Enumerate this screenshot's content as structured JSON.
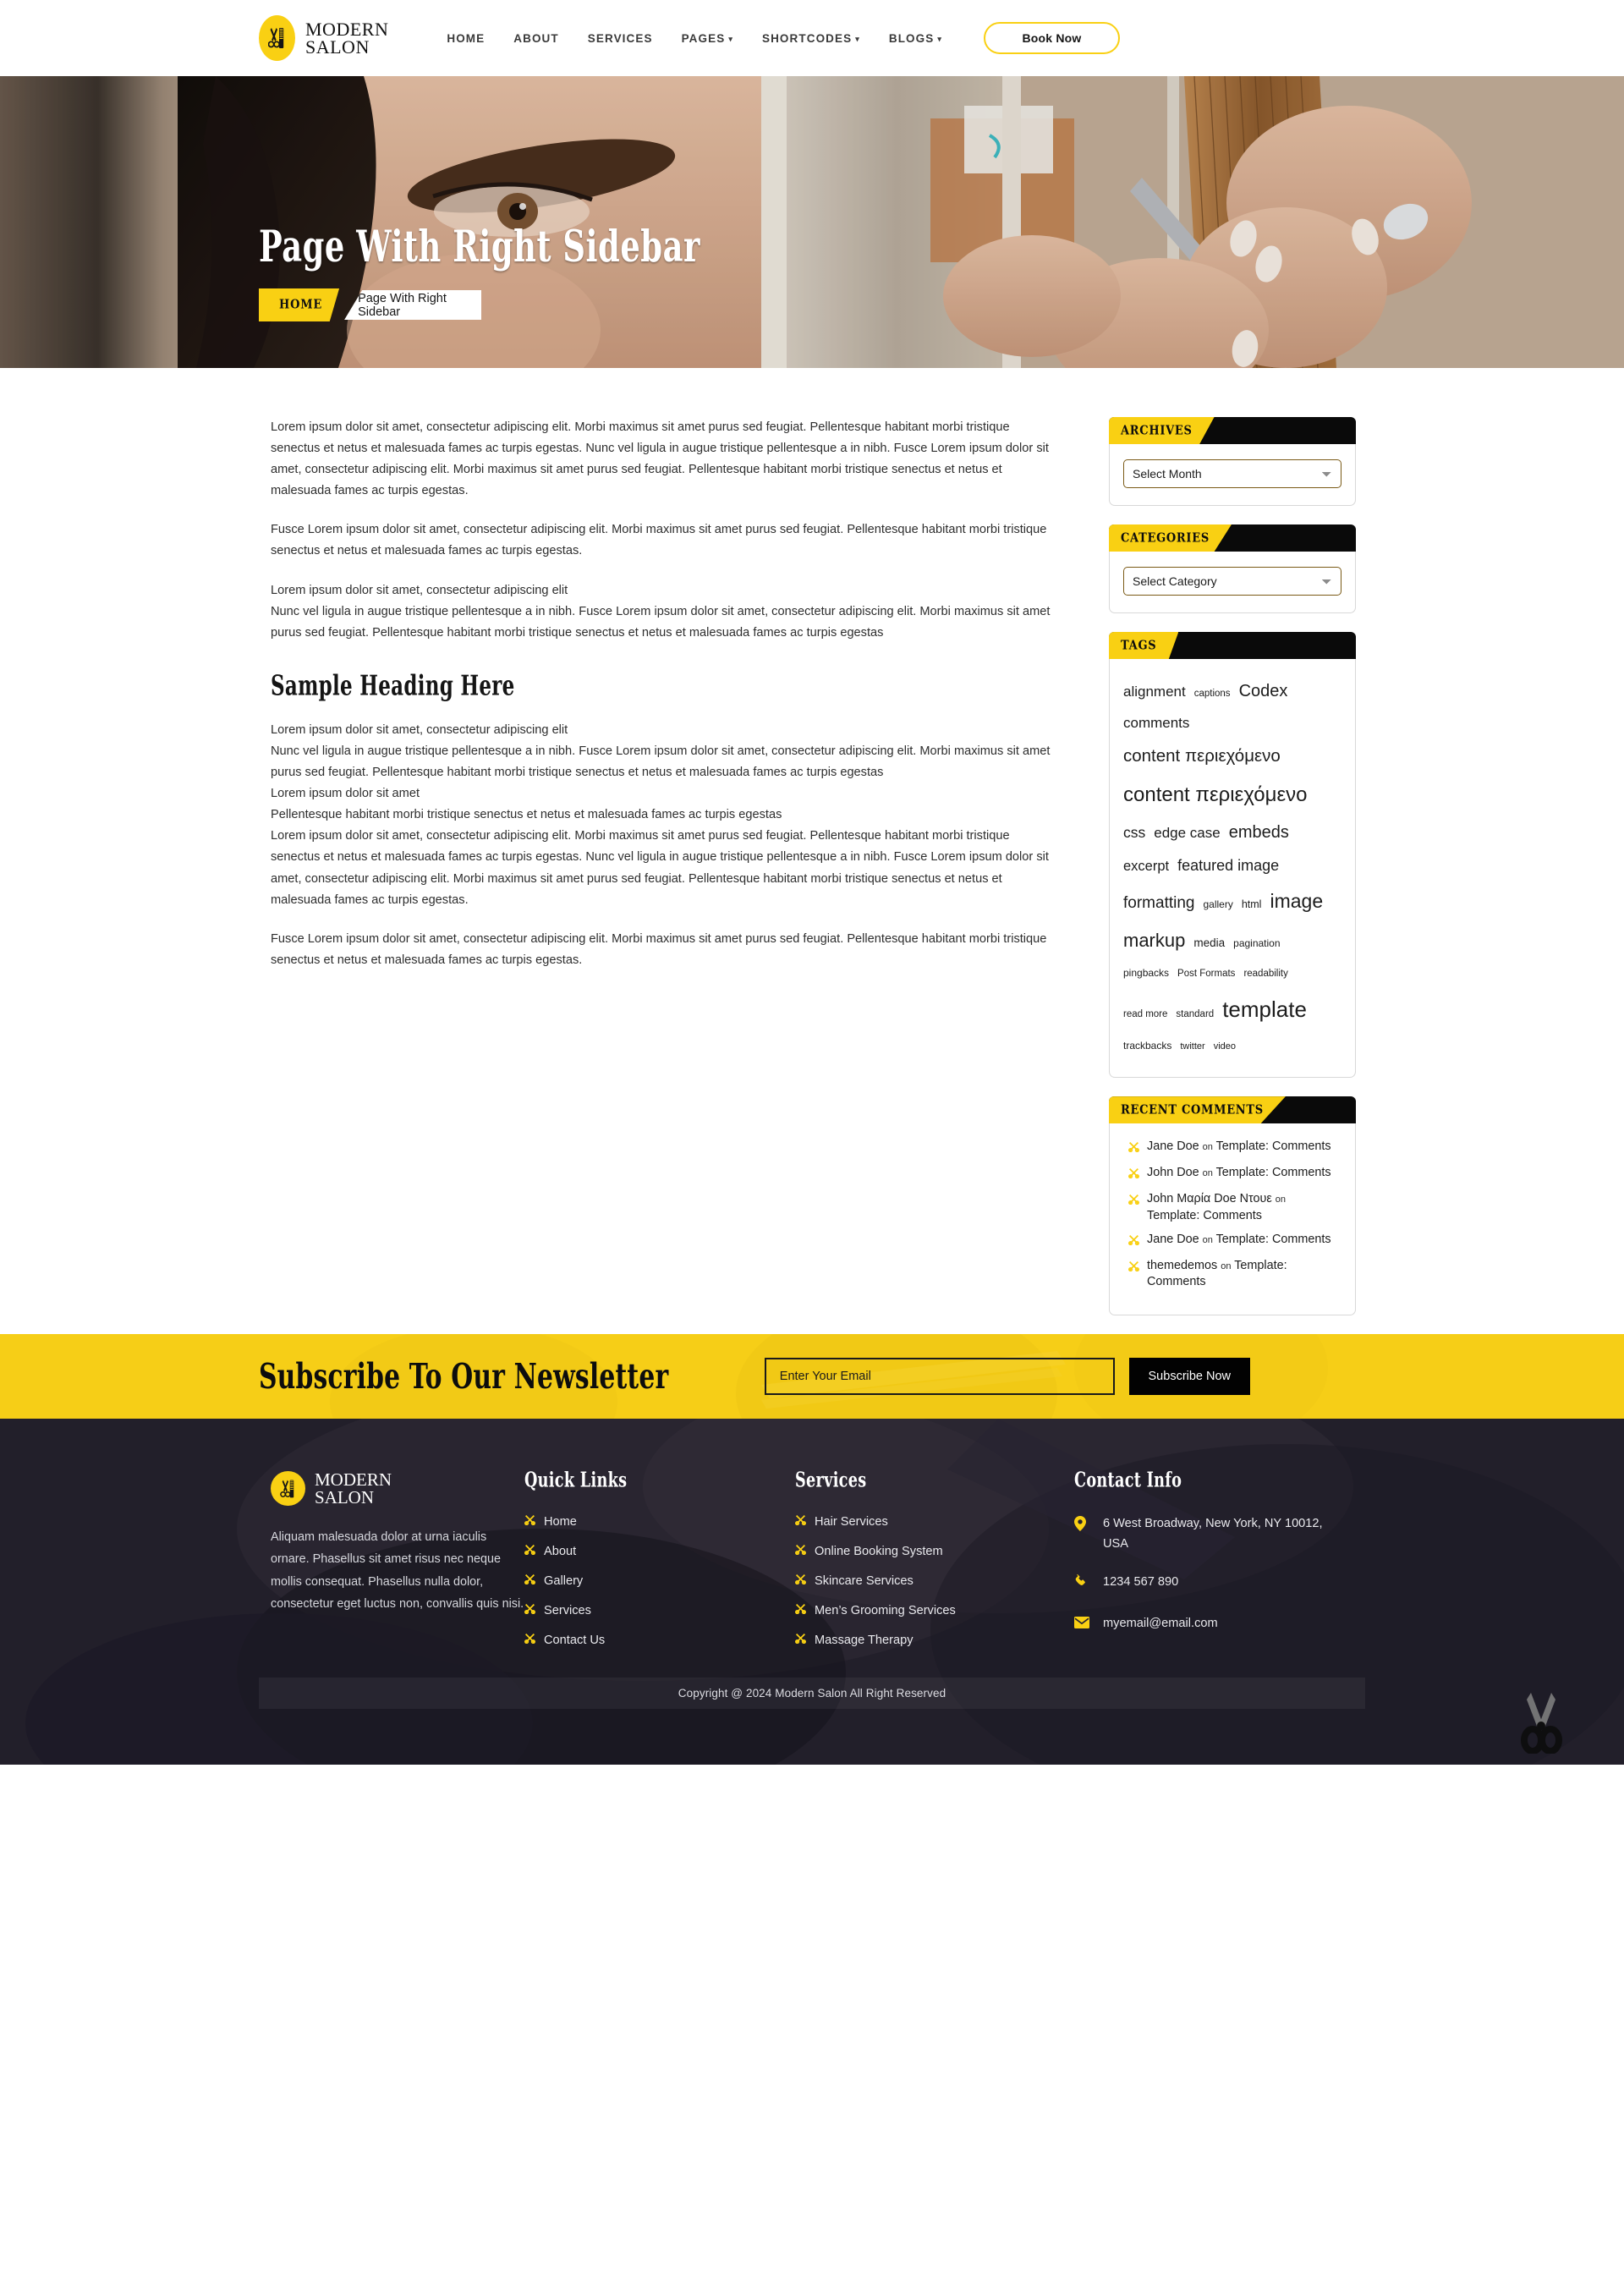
{
  "header": {
    "logo": {
      "line1": "MODERN",
      "line2": "SALON",
      "icon": "scissors-comb-icon"
    },
    "nav": [
      {
        "label": "HOME",
        "has_dropdown": false
      },
      {
        "label": "ABOUT",
        "has_dropdown": false
      },
      {
        "label": "SERVICES",
        "has_dropdown": false
      },
      {
        "label": "PAGES",
        "has_dropdown": true
      },
      {
        "label": "SHORTCODES",
        "has_dropdown": true
      },
      {
        "label": "BLOGS",
        "has_dropdown": true
      }
    ],
    "cta_label": "Book Now"
  },
  "hero": {
    "title": "Page With Right Sidebar",
    "breadcrumb_home": "HOME",
    "breadcrumb_current": "Page With Right Sidebar"
  },
  "content": {
    "p1": "Lorem ipsum dolor sit amet, consectetur adipiscing elit. Morbi maximus sit amet purus sed feugiat. Pellentesque habitant morbi tristique senectus et netus et malesuada fames ac turpis egestas. Nunc vel ligula in augue tristique pellentesque a in nibh. Fusce Lorem ipsum dolor sit amet, consectetur adipiscing elit. Morbi maximus sit amet purus sed feugiat. Pellentesque habitant morbi tristique senectus et netus et malesuada fames ac turpis egestas.",
    "p2": "Fusce Lorem ipsum dolor sit amet, consectetur adipiscing elit. Morbi maximus sit amet purus sed feugiat. Pellentesque habitant morbi tristique senectus et netus et malesuada fames ac turpis egestas.",
    "p3_line1": "Lorem ipsum dolor sit amet, consectetur adipiscing elit",
    "p3_line2": "Nunc vel ligula in augue tristique pellentesque a in nibh. Fusce Lorem ipsum dolor sit amet, consectetur adipiscing elit. Morbi maximus sit amet purus sed feugiat. Pellentesque habitant morbi tristique senectus et netus et malesuada fames ac turpis egestas",
    "heading": "Sample Heading Here",
    "p4_line1": "Lorem ipsum dolor sit amet, consectetur adipiscing elit",
    "p4_line2": "Nunc vel ligula in augue tristique pellentesque a in nibh. Fusce Lorem ipsum dolor sit amet, consectetur adipiscing elit. Morbi maximus sit amet purus sed feugiat. Pellentesque habitant morbi tristique senectus et netus et malesuada fames ac turpis egestas",
    "p4_line3": "Lorem ipsum dolor sit amet",
    "p4_line4": "Pellentesque habitant morbi tristique senectus et netus et malesuada fames ac turpis egestas",
    "p4_line5": "Lorem ipsum dolor sit amet, consectetur adipiscing elit. Morbi maximus sit amet purus sed feugiat. Pellentesque habitant morbi tristique senectus et netus et malesuada fames ac turpis egestas. Nunc vel ligula in augue tristique pellentesque a in nibh. Fusce Lorem ipsum dolor sit amet, consectetur adipiscing elit. Morbi maximus sit amet purus sed feugiat. Pellentesque habitant morbi tristique senectus et netus et malesuada fames ac turpis egestas.",
    "p5": "Fusce Lorem ipsum dolor sit amet, consectetur adipiscing elit. Morbi maximus sit amet purus sed feugiat. Pellentesque habitant morbi tristique senectus et netus et malesuada fames ac turpis egestas."
  },
  "sidebar": {
    "archives": {
      "title": "ARCHIVES",
      "selected": "Select Month"
    },
    "categories": {
      "title": "CATEGORIES",
      "selected": "Select Category"
    },
    "tags": {
      "title": "TAGS",
      "items": [
        {
          "label": "alignment",
          "size": 17
        },
        {
          "label": "captions",
          "size": 11.5
        },
        {
          "label": "Codex",
          "size": 20
        },
        {
          "label": "comments",
          "size": 17
        },
        {
          "label": "content περιεχόμενο",
          "size": 20.5
        },
        {
          "label": "content περιεχόμενο",
          "size": 24
        },
        {
          "label": "css",
          "size": 17.5
        },
        {
          "label": "edge case",
          "size": 17
        },
        {
          "label": "embeds",
          "size": 20
        },
        {
          "label": "excerpt",
          "size": 16.5
        },
        {
          "label": "featured image",
          "size": 18
        },
        {
          "label": "formatting",
          "size": 19
        },
        {
          "label": "gallery",
          "size": 12
        },
        {
          "label": "html",
          "size": 12.5
        },
        {
          "label": "image",
          "size": 23
        },
        {
          "label": "markup",
          "size": 22
        },
        {
          "label": "media",
          "size": 13.5
        },
        {
          "label": "pagination",
          "size": 12
        },
        {
          "label": "pingbacks",
          "size": 12
        },
        {
          "label": "Post Formats",
          "size": 11.5
        },
        {
          "label": "readability",
          "size": 11.5
        },
        {
          "label": "read more",
          "size": 11.5
        },
        {
          "label": "standard",
          "size": 11.5
        },
        {
          "label": "template",
          "size": 26
        },
        {
          "label": "trackbacks",
          "size": 12
        },
        {
          "label": "twitter",
          "size": 11
        },
        {
          "label": "video",
          "size": 11
        }
      ]
    },
    "recent_comments": {
      "title": "RECENT COMMENTS",
      "items": [
        {
          "author": "Jane Doe",
          "on": "on",
          "post": "Template: Comments"
        },
        {
          "author": "John Doe",
          "on": "on",
          "post": "Template: Comments"
        },
        {
          "author": "John Μαρία Doe Ντουε",
          "on": "on",
          "post": "Template: Comments"
        },
        {
          "author": "Jane Doe",
          "on": "on",
          "post": "Template: Comments"
        },
        {
          "author": "themedemos",
          "on": "on",
          "post": "Template: Comments"
        }
      ]
    }
  },
  "newsletter": {
    "title": "Subscribe To Our Newsletter",
    "placeholder": "Enter Your Email",
    "value": "",
    "button_label": "Subscribe Now"
  },
  "footer": {
    "logo": {
      "line1": "MODERN",
      "line2": "SALON"
    },
    "about_text": "Aliquam malesuada dolor at urna iaculis ornare. Phasellus sit amet risus nec neque mollis consequat. Phasellus nulla dolor, consectetur eget luctus non, convallis quis nisi.",
    "quick_links": {
      "title": "Quick Links",
      "items": [
        "Home",
        "About",
        "Gallery",
        "Services",
        "Contact Us"
      ]
    },
    "services": {
      "title": "Services",
      "items": [
        "Hair Services",
        "Online Booking System",
        "Skincare Services",
        "Men’s Grooming Services",
        "Massage Therapy"
      ]
    },
    "contact": {
      "title": "Contact Info",
      "address": "6 West Broadway, New York, NY 10012, USA",
      "phone": "1234 567 890",
      "email": "myemail@email.com"
    },
    "copyright": "Copyright @ 2024 Modern Salon All Right Reserved"
  },
  "colors": {
    "accent_yellow": "#F9D013",
    "newsletter_yellow": "#F6CE17",
    "footer_dark": "#272430",
    "black": "#0a0a0a"
  }
}
